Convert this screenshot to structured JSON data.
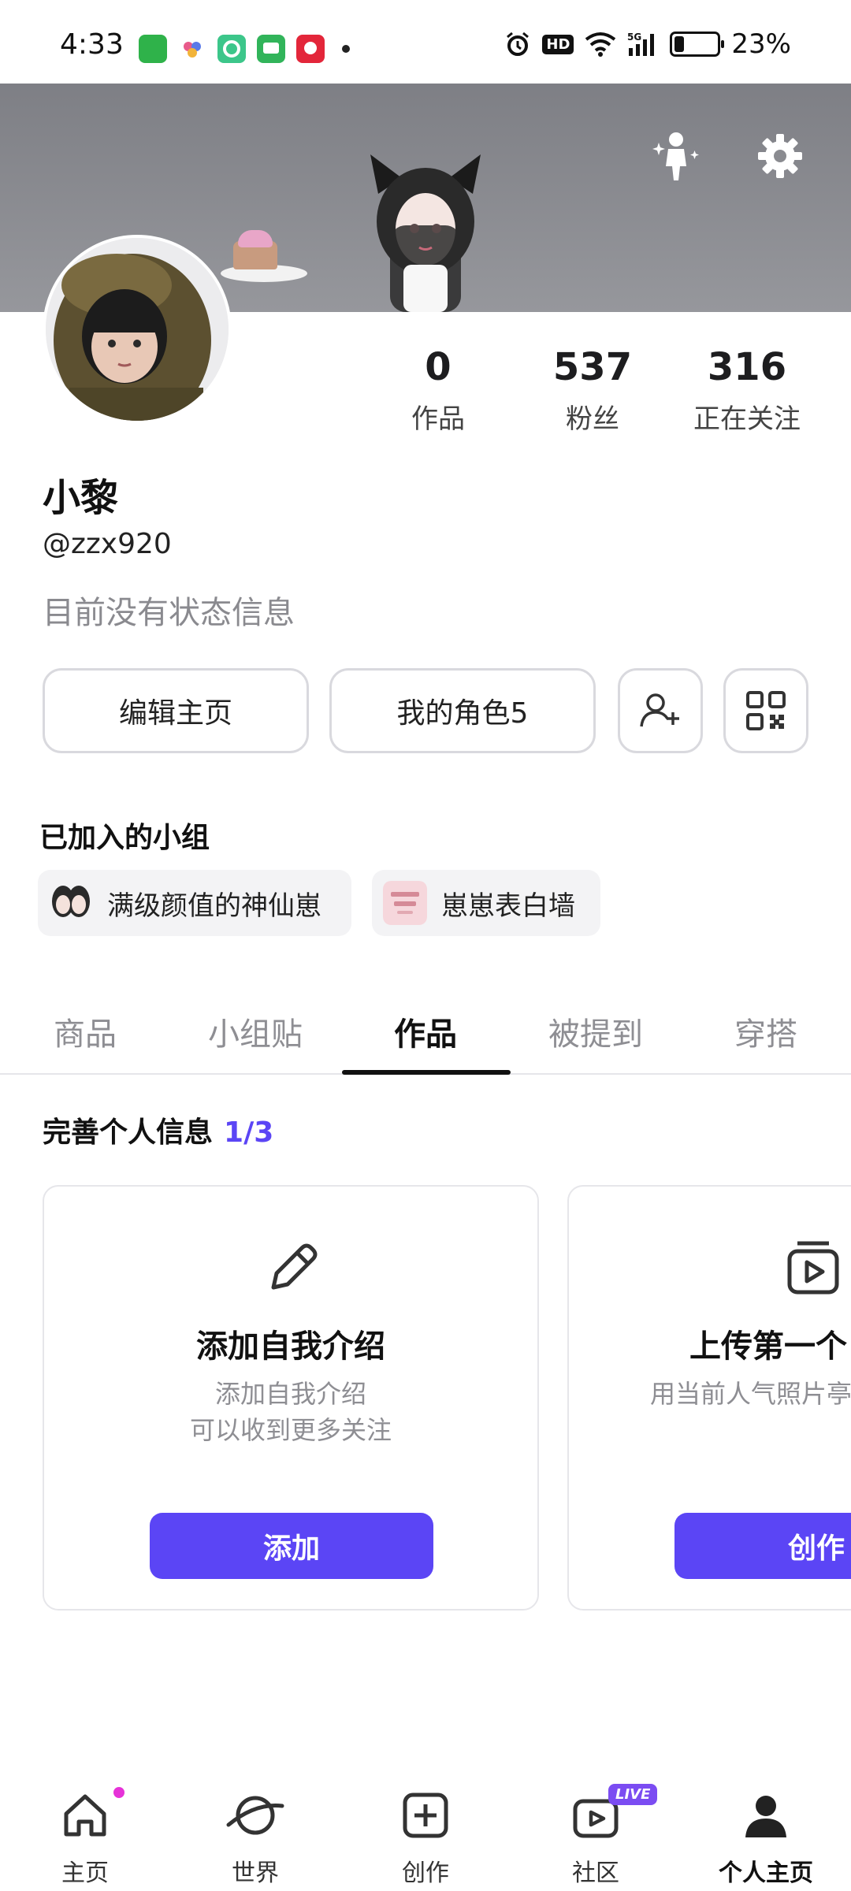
{
  "status_bar": {
    "time": "4:33",
    "battery": "23%",
    "battery_level": 0.23,
    "network_label": "5G",
    "hd_label": "HD"
  },
  "profile": {
    "name": "小黎",
    "handle": "@zzx920",
    "bio": "目前没有状态信息"
  },
  "stats": [
    {
      "value": "0",
      "label": "作品"
    },
    {
      "value": "537",
      "label": "粉丝"
    },
    {
      "value": "316",
      "label": "正在关注"
    }
  ],
  "actions": {
    "edit_profile": "编辑主页",
    "my_characters": "我的角色5"
  },
  "groups": {
    "title": "已加入的小组",
    "items": [
      {
        "label": "满级颜值的神仙崽"
      },
      {
        "label": "崽崽表白墙"
      }
    ]
  },
  "tabs": [
    {
      "label": "商品"
    },
    {
      "label": "小组贴"
    },
    {
      "label": "作品"
    },
    {
      "label": "被提到"
    },
    {
      "label": "穿搭"
    }
  ],
  "active_tab": "作品",
  "complete_info": {
    "title": "完善个人信息",
    "progress": "1/3",
    "cards": [
      {
        "title": "添加自我介绍",
        "desc_line1": "添加自我介绍",
        "desc_line2": "可以收到更多关注",
        "button": "添加"
      },
      {
        "title": "上传第一个",
        "desc_line1": "用当前人气照片亭创作",
        "desc_line2": "",
        "button": "创作"
      }
    ]
  },
  "bottom_nav": [
    {
      "label": "主页"
    },
    {
      "label": "世界"
    },
    {
      "label": "创作"
    },
    {
      "label": "社区",
      "badge": "LIVE"
    },
    {
      "label": "个人主页"
    }
  ],
  "colors": {
    "accent": "#5b45f5",
    "live_badge": "#7b4cf2",
    "home_dot": "#e632d8",
    "banner_top": "#7e7f85"
  }
}
